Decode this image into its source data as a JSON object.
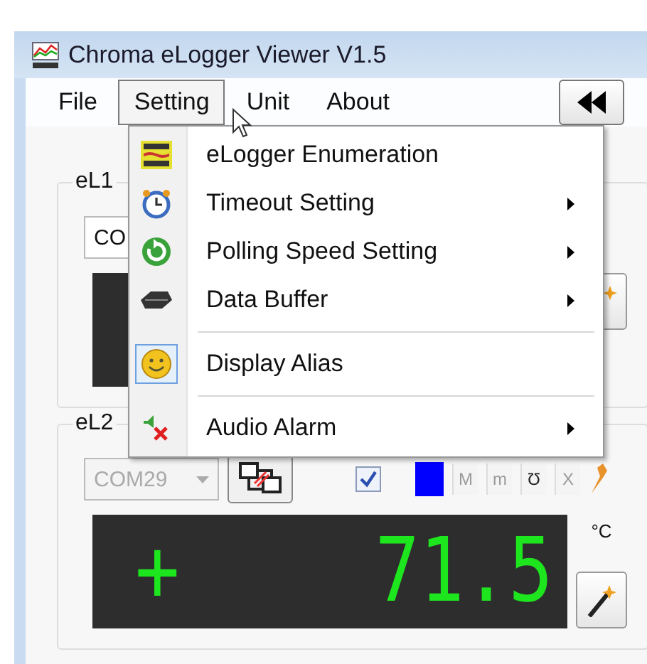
{
  "window": {
    "title": "Chroma eLogger Viewer V1.5"
  },
  "menu_bar": [
    {
      "label": "File",
      "selected": false
    },
    {
      "label": "Setting",
      "selected": true
    },
    {
      "label": "Unit",
      "selected": false
    },
    {
      "label": "About",
      "selected": false
    }
  ],
  "dropdown": [
    {
      "kind": "item",
      "label": "eLogger Enumeration",
      "has_submenu": false,
      "checked": false
    },
    {
      "kind": "item",
      "label": "Timeout Setting",
      "has_submenu": true,
      "checked": false
    },
    {
      "kind": "item",
      "label": "Polling Speed Setting",
      "has_submenu": true,
      "checked": false
    },
    {
      "kind": "item",
      "label": "Data Buffer",
      "has_submenu": true,
      "checked": false
    },
    {
      "kind": "separator"
    },
    {
      "kind": "item",
      "label": "Display Alias",
      "has_submenu": false,
      "checked": true
    },
    {
      "kind": "separator"
    },
    {
      "kind": "item",
      "label": "Audio Alarm",
      "has_submenu": true,
      "checked": false
    }
  ],
  "loggers": [
    {
      "label": "eL1",
      "port": "CO"
    },
    {
      "label": "eL2",
      "port": "COM29",
      "port_disabled": true,
      "enabled": true,
      "color": "#0000ff",
      "tool_buttons": [
        {
          "label": "M",
          "disabled": true
        },
        {
          "label": "m",
          "disabled": true
        },
        {
          "label": "Ʊ",
          "disabled": false
        },
        {
          "label": "X",
          "disabled": true
        }
      ],
      "sign": "+",
      "value": "71.5",
      "unit": "°C"
    }
  ]
}
